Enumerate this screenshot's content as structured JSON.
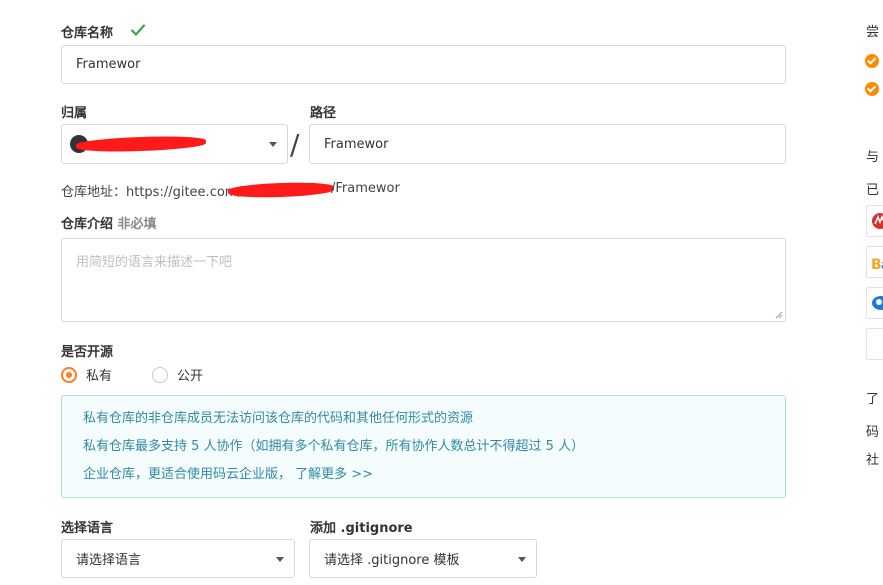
{
  "form": {
    "repo_name_label": "仓库名称",
    "repo_name_value": "Framewor",
    "owner_label": "归属",
    "path_label": "路径",
    "path_separator": "/",
    "path_value": "Framewor",
    "address_prefix": "仓库地址：https://gitee.com/",
    "address_suffix": "/Framewor",
    "intro_label": "仓库介绍",
    "intro_optional": "非必填",
    "intro_placeholder": "用简短的语言来描述一下吧",
    "open_source_label": "是否开源",
    "visibility_options": [
      {
        "label": "私有",
        "selected": true
      },
      {
        "label": "公开",
        "selected": false
      }
    ],
    "notice_lines": [
      "私有仓库的非仓库成员无法访问该仓库的代码和其他任何形式的资源",
      "私有仓库最多支持 5 人协作（如拥有多个私有仓库，所有协作人数总计不得超过 5 人）"
    ],
    "notice_enterprise": "企业仓库，更适合使用码云企业版，",
    "notice_more_link": "了解更多 >>",
    "language_label": "选择语言",
    "language_value": "请选择语言",
    "gitignore_label": "添加 .gitignore",
    "gitignore_value": "请选择 .gitignore 模板"
  },
  "sidebar": {
    "t1": "尝",
    "t2": "与",
    "t3": "已",
    "t4": "了",
    "t5": "码",
    "t6": "社"
  },
  "colors": {
    "accent": "#ff7d1f",
    "check_green": "#3fa34d",
    "notice_border": "#a6dfea",
    "notice_text": "#2f8ba3",
    "redaction": "#ff1a1a"
  }
}
